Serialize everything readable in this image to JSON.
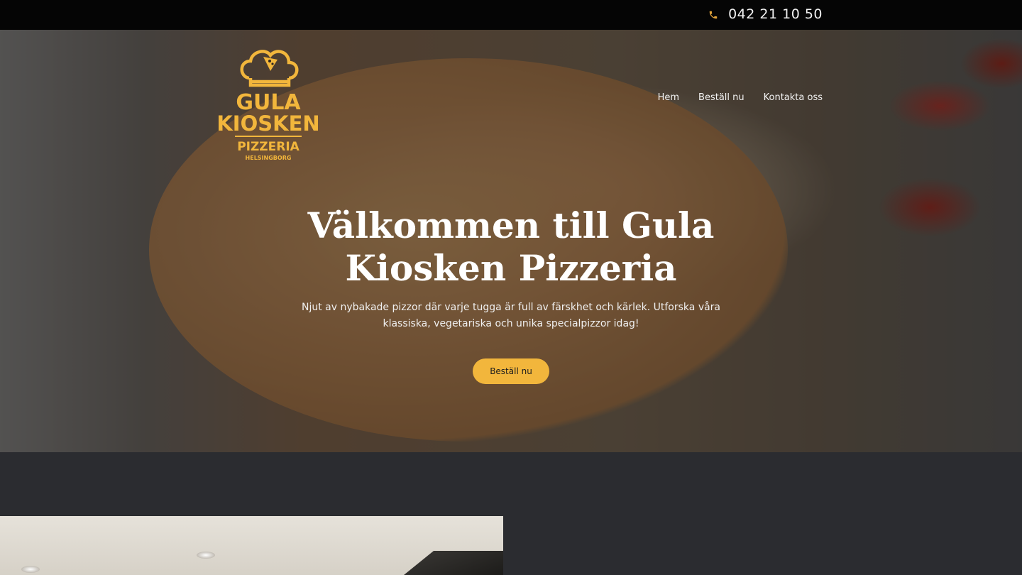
{
  "topbar": {
    "phone": "042 21 10 50",
    "phone_icon": "phone-icon",
    "accent_color": "#f2b63c"
  },
  "logo": {
    "line1": "GULA",
    "line2": "KIOSKEN",
    "line3": "PIZZERIA",
    "line4": "HELSINGBORG",
    "color": "#f2b63c"
  },
  "nav": {
    "items": [
      {
        "label": "Hem"
      },
      {
        "label": "Beställ nu"
      },
      {
        "label": "Kontakta oss"
      }
    ]
  },
  "hero": {
    "title": "Välkommen till Gula Kiosken Pizzeria",
    "subtitle": "Njut av nybakade pizzor  där varje tugga är full av färskhet och kärlek. Utforska våra klassiska, vegetariska och unika specialpizzor idag!",
    "cta_label": "Beställ nu"
  },
  "colors": {
    "topbar_bg": "#050505",
    "section_bg": "#2b2c30",
    "cta_bg": "#f2b63c"
  }
}
